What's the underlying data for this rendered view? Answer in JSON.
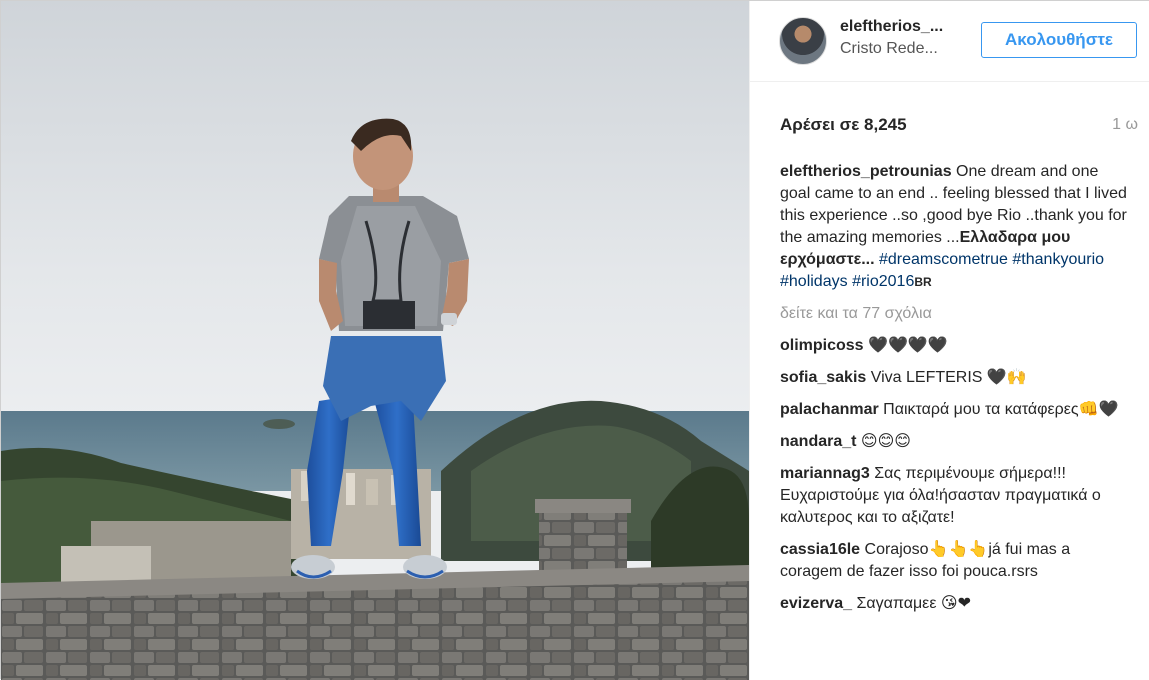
{
  "post": {
    "author": {
      "username_short": "eleftherios_...",
      "location_short": "Cristo Rede...",
      "follow_label": "Ακολουθήστε"
    },
    "likes_label": "Αρέσει σε 8,245",
    "time_ago": "1 ω",
    "caption": {
      "username": "eleftherios_petrounias",
      "text": " One dream and one goal came to an end .. feeling blessed that I lived this experience ..so ,good bye Rio ..thank you for the amazing memories ...",
      "bold_text": "Ελλαδαρα μου ερχόμαστε...",
      "hashtags": [
        "#dreamscometrue",
        "#thankyourio",
        "#holidays",
        "#rio2016"
      ],
      "br_flag": "BR"
    },
    "view_all_comments": "δείτε και τα 77 σχόλια",
    "comments": [
      {
        "user": "olimpicoss",
        "text": " 🖤🖤🖤🖤"
      },
      {
        "user": "sofia_sakis",
        "text": " Viva LEFTERIS 🖤🙌"
      },
      {
        "user": "palachanmar",
        "text": " Παικταρά μου τα κατάφερες👊🖤"
      },
      {
        "user": "nandara_t",
        "text": " 😊😊😊"
      },
      {
        "user": "mariannag3",
        "text": " Σας περιμένουμε σήμερα!!! Ευχαριστούμε για όλα!ήσασταν πραγματικά ο καλυτερος και το αξιζατε!"
      },
      {
        "user": "cassia16le",
        "text": " Corajoso👆👆👆já fui mas a coragem de fazer isso foi pouca.rsrs"
      },
      {
        "user": "evizerva_",
        "text": " Σαγαπαμεε 😘❤"
      }
    ]
  }
}
